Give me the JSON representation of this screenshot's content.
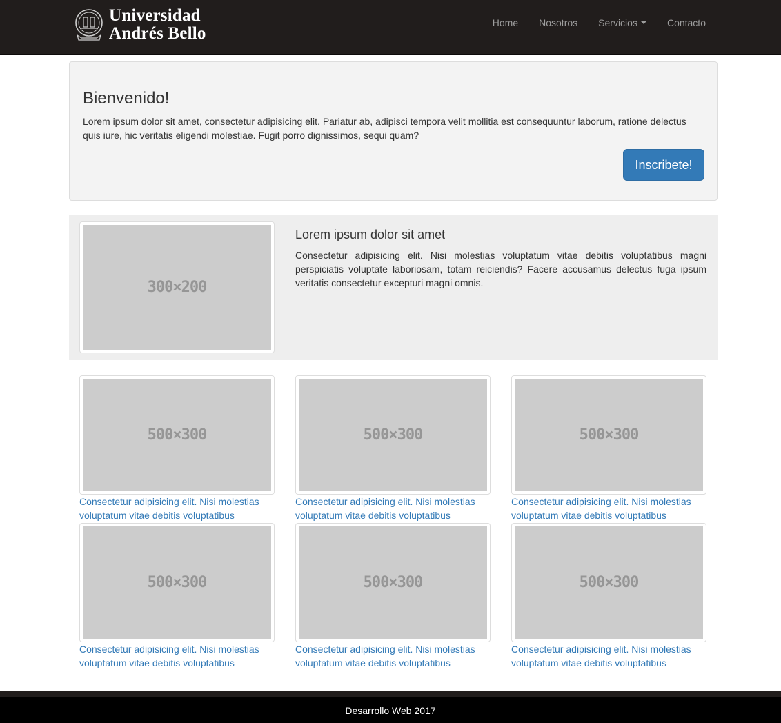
{
  "brand": {
    "line1": "Universidad",
    "line2": "Andrés Bello"
  },
  "nav": {
    "items": [
      {
        "label": "Home"
      },
      {
        "label": "Nosotros"
      },
      {
        "label": "Servicios"
      },
      {
        "label": "Contacto"
      }
    ]
  },
  "jumbotron": {
    "title": "Bienvenido!",
    "text": "Lorem ipsum dolor sit amet, consectetur adipisicing elit. Pariatur ab, adipisci tempora velit mollitia est consequuntur laborum, ratione delectus quis iure, hic veritatis eligendi molestiae. Fugit porro dignissimos, sequi quam?",
    "button": "Inscribete!"
  },
  "media": {
    "image_label": "300×200",
    "heading": "Lorem ipsum dolor sit amet",
    "text": "Consectetur adipisicing elit. Nisi molestias voluptatum vitae debitis voluptatibus magni perspiciatis voluptate laboriosam, totam reiciendis? Facere accusamus delectus fuga ipsum veritatis consectetur excepturi magni omnis."
  },
  "grid": [
    {
      "image_label": "500×300",
      "caption": "Consectetur adipisicing elit. Nisi molestias voluptatum vitae debitis voluptatibus"
    },
    {
      "image_label": "500×300",
      "caption": "Consectetur adipisicing elit. Nisi molestias voluptatum vitae debitis voluptatibus"
    },
    {
      "image_label": "500×300",
      "caption": "Consectetur adipisicing elit. Nisi molestias voluptatum vitae debitis voluptatibus"
    },
    {
      "image_label": "500×300",
      "caption": "Consectetur adipisicing elit. Nisi molestias voluptatum vitae debitis voluptatibus"
    },
    {
      "image_label": "500×300",
      "caption": "Consectetur adipisicing elit. Nisi molestias voluptatum vitae debitis voluptatibus"
    },
    {
      "image_label": "500×300",
      "caption": "Consectetur adipisicing elit. Nisi molestias voluptatum vitae debitis voluptatibus"
    }
  ],
  "footer": {
    "text": "Desarrollo Web 2017"
  },
  "colors": {
    "navbar": "#211d1c",
    "primary": "#337ab7",
    "footer": "#000000"
  }
}
